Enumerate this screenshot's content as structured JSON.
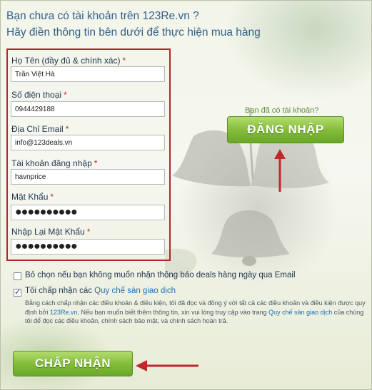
{
  "header": {
    "line1": "Bạn chưa có tài khoản trên 123Re.vn ?",
    "line2": "Hãy điền thông tin bên dưới để thực hiện mua hàng"
  },
  "form": {
    "required_mark": "*",
    "fullname": {
      "label": "Họ Tên (đầy đủ & chính xác)",
      "value": "Trần Việt Hà"
    },
    "phone": {
      "label": "Số điện thoại",
      "value": "0944429188"
    },
    "email": {
      "label": "Địa Chỉ Email",
      "value": "info@123deals.vn"
    },
    "username": {
      "label": "Tài khoản đăng nhập",
      "value": "havnprice"
    },
    "password": {
      "label": "Mật Khẩu",
      "value": "●●●●●●●●●●"
    },
    "password_confirm": {
      "label": "Nhập Lại Mật Khẩu",
      "value": "●●●●●●●●●●"
    }
  },
  "login_prompt": "Bạn đã có tài khoản?",
  "login_button": "ĐĂNG NHẬP",
  "options": {
    "no_deals": {
      "label": "Bỏ chọn nếu bạn không muốn nhận thông báo deals hàng ngày qua Email",
      "checked": false
    },
    "agree": {
      "label_prefix": "Tôi chấp nhận các ",
      "label_link": "Quy chế sàn giao dịch",
      "checked": true
    }
  },
  "terms": {
    "part1": "Bằng cách chấp nhận các điều khoản & điều kiện, tôi đã đọc và đồng ý với tất cả các điều khoản và điều kiện được quy định bởi ",
    "site_link": "123Re.vn",
    "part2": ". Nếu bạn muốn biết thêm thông tin, xin vui lòng truy cập vào trang ",
    "rules_link": "Quy chế sàn giao dịch",
    "part3": " của chúng tôi để đọc các điều khoản, chính sách bảo mật, và chính sách hoàn trả."
  },
  "accept_button": "CHẤP NHẬN",
  "colors": {
    "header_text": "#2f5f8a",
    "highlight_border": "#b3262d",
    "button_green": "#85bd3b",
    "arrow_red": "#c0282e",
    "link_blue": "#1d6fb8"
  }
}
